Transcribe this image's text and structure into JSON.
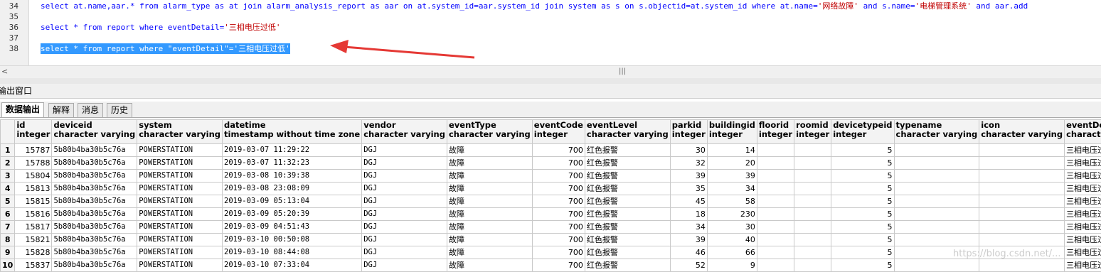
{
  "editor": {
    "lines": [
      {
        "num": "34",
        "parts": [
          {
            "t": "select at.name,aar.* from alarm_type as at join alarm_analysis_report as aar on at.system_id=aar.system_id join system as s on s.objectid=at.system_id where at.name=",
            "c": "kw"
          },
          {
            "t": "'网络故障'",
            "c": "str"
          },
          {
            "t": " and s.name=",
            "c": "kw"
          },
          {
            "t": "'电梯管理系统'",
            "c": "str"
          },
          {
            "t": " and aar.add",
            "c": "kw"
          }
        ]
      },
      {
        "num": "35",
        "parts": []
      },
      {
        "num": "36",
        "parts": [
          {
            "t": "select * from report where eventDetail=",
            "c": "kw"
          },
          {
            "t": "'三相电压过低'",
            "c": "str"
          }
        ]
      },
      {
        "num": "37",
        "parts": []
      },
      {
        "num": "38",
        "selected": true,
        "parts": [
          {
            "t": "select * from report where \"eventDetail\"=",
            "c": "kw"
          },
          {
            "t": "'三相电压过低'",
            "c": "str"
          }
        ]
      }
    ],
    "hscroll_left": "<",
    "hscroll_grip": "|||",
    "arrow_color": "#e53935"
  },
  "output": {
    "title": "输出窗口",
    "tabs": [
      "数据输出",
      "解释",
      "消息",
      "历史"
    ],
    "columns": [
      {
        "name": "id",
        "type": "integer"
      },
      {
        "name": "deviceid",
        "type": "character varying"
      },
      {
        "name": "system",
        "type": "character varying"
      },
      {
        "name": "datetime",
        "type": "timestamp without time zone"
      },
      {
        "name": "vendor",
        "type": "character varying"
      },
      {
        "name": "eventType",
        "type": "character varying"
      },
      {
        "name": "eventCode",
        "type": "integer"
      },
      {
        "name": "eventLevel",
        "type": "character varying"
      },
      {
        "name": "parkid",
        "type": "integer"
      },
      {
        "name": "buildingid",
        "type": "integer"
      },
      {
        "name": "floorid",
        "type": "integer"
      },
      {
        "name": "roomid",
        "type": "integer"
      },
      {
        "name": "devicetypeid",
        "type": "integer"
      },
      {
        "name": "typename",
        "type": "character varying"
      },
      {
        "name": "icon",
        "type": "character varying"
      },
      {
        "name": "eventDetail",
        "type": "character varying"
      }
    ],
    "rows": [
      {
        "n": "1",
        "cells": [
          "15787",
          "5b80b4ba30b5c76a",
          "POWERSTATION",
          "2019-03-07 11:29:22",
          "DGJ",
          "故障",
          "700",
          "红色报警",
          "30",
          "14",
          "",
          "",
          "5",
          "",
          "",
          "三相电压过低"
        ]
      },
      {
        "n": "2",
        "cells": [
          "15788",
          "5b80b4ba30b5c76a",
          "POWERSTATION",
          "2019-03-07 11:32:23",
          "DGJ",
          "故障",
          "700",
          "红色报警",
          "32",
          "20",
          "",
          "",
          "5",
          "",
          "",
          "三相电压过低"
        ]
      },
      {
        "n": "3",
        "cells": [
          "15804",
          "5b80b4ba30b5c76a",
          "POWERSTATION",
          "2019-03-08 10:39:38",
          "DGJ",
          "故障",
          "700",
          "红色报警",
          "39",
          "39",
          "",
          "",
          "5",
          "",
          "",
          "三相电压过低"
        ]
      },
      {
        "n": "4",
        "cells": [
          "15813",
          "5b80b4ba30b5c76a",
          "POWERSTATION",
          "2019-03-08 23:08:09",
          "DGJ",
          "故障",
          "700",
          "红色报警",
          "35",
          "34",
          "",
          "",
          "5",
          "",
          "",
          "三相电压过低"
        ]
      },
      {
        "n": "5",
        "cells": [
          "15815",
          "5b80b4ba30b5c76a",
          "POWERSTATION",
          "2019-03-09 05:13:04",
          "DGJ",
          "故障",
          "700",
          "红色报警",
          "45",
          "58",
          "",
          "",
          "5",
          "",
          "",
          "三相电压过低"
        ]
      },
      {
        "n": "6",
        "cells": [
          "15816",
          "5b80b4ba30b5c76a",
          "POWERSTATION",
          "2019-03-09 05:20:39",
          "DGJ",
          "故障",
          "700",
          "红色报警",
          "18",
          "230",
          "",
          "",
          "5",
          "",
          "",
          "三相电压过低"
        ]
      },
      {
        "n": "7",
        "cells": [
          "15817",
          "5b80b4ba30b5c76a",
          "POWERSTATION",
          "2019-03-09 04:51:43",
          "DGJ",
          "故障",
          "700",
          "红色报警",
          "34",
          "30",
          "",
          "",
          "5",
          "",
          "",
          "三相电压过低"
        ]
      },
      {
        "n": "8",
        "cells": [
          "15821",
          "5b80b4ba30b5c76a",
          "POWERSTATION",
          "2019-03-10 00:50:08",
          "DGJ",
          "故障",
          "700",
          "红色报警",
          "39",
          "40",
          "",
          "",
          "5",
          "",
          "",
          "三相电压过低"
        ]
      },
      {
        "n": "9",
        "cells": [
          "15828",
          "5b80b4ba30b5c76a",
          "POWERSTATION",
          "2019-03-10 08:44:08",
          "DGJ",
          "故障",
          "700",
          "红色报警",
          "46",
          "66",
          "",
          "",
          "5",
          "",
          "",
          "三相电压过低"
        ]
      },
      {
        "n": "10",
        "cells": [
          "15837",
          "5b80b4ba30b5c76a",
          "POWERSTATION",
          "2019-03-10 07:33:04",
          "DGJ",
          "故障",
          "700",
          "红色报警",
          "52",
          "9",
          "",
          "",
          "5",
          "",
          "",
          "三相电压过低"
        ]
      }
    ],
    "watermark": "https://blog.csdn.net/..."
  }
}
